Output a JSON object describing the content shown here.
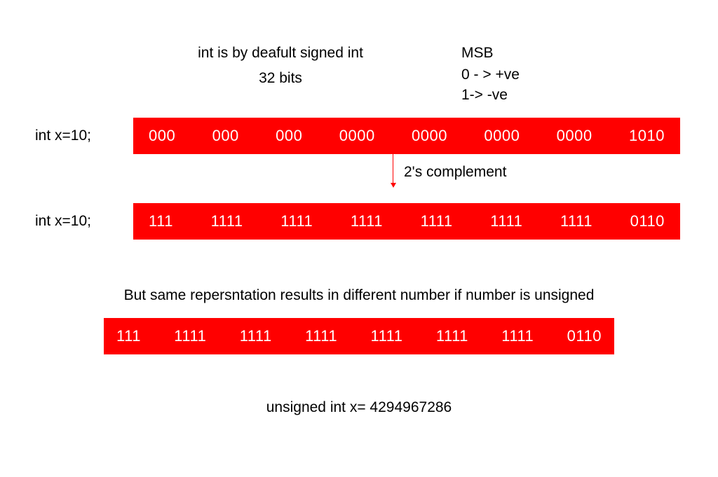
{
  "header": {
    "line1": "int is by deafult signed int",
    "line2": "32 bits",
    "msb_label": "MSB",
    "msb_pos": "0 - > +ve",
    "msb_neg": "1-> -ve"
  },
  "row1": {
    "label": "int x=10;",
    "groups": [
      "000",
      "000",
      "000",
      "0000",
      "0000",
      "0000",
      "0000",
      "1010"
    ]
  },
  "middle": {
    "arrow_caption": "2's complement"
  },
  "row2": {
    "label": "int x=10;",
    "groups": [
      "111",
      "1111",
      "1111",
      "1111",
      "1111",
      "1111",
      "1111",
      "0110"
    ]
  },
  "note": "But same repersntation results in different number if number is unsigned",
  "row3": {
    "groups": [
      "111",
      "1111",
      "1111",
      "1111",
      "1111",
      "1111",
      "1111",
      "0110"
    ]
  },
  "footer": "unsigned int x= 4294967286",
  "colors": {
    "bar": "#ff0000",
    "bar_text": "#ffffff"
  }
}
